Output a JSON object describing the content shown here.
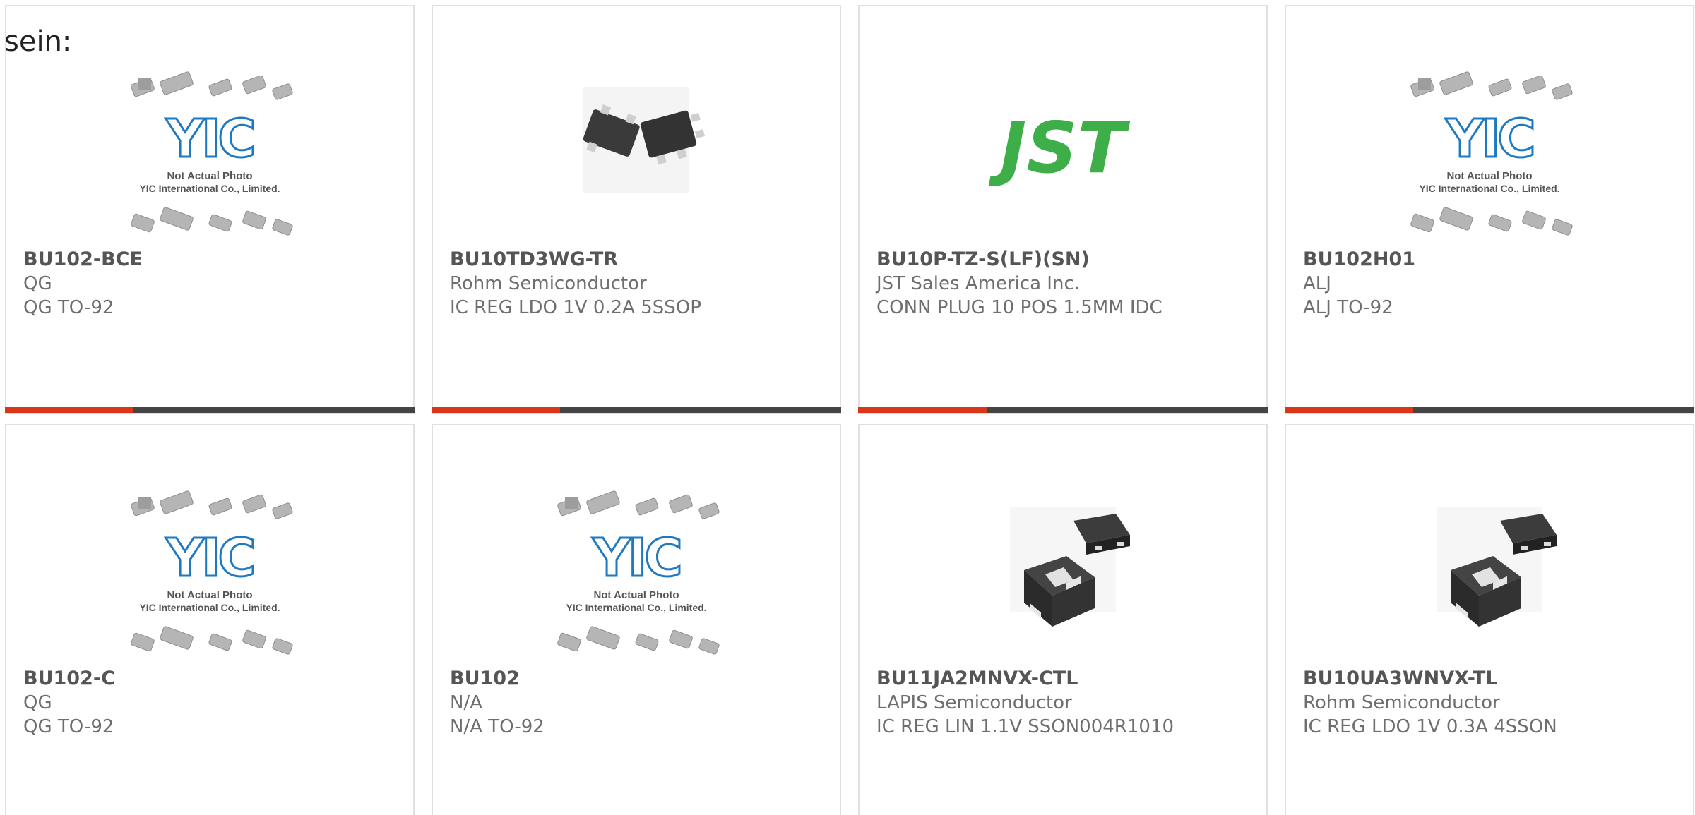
{
  "intro_text": "sein:",
  "accent_color": "#d9361a",
  "bar_color": "#444444",
  "cards": [
    {
      "part": "BU102-BCE",
      "maker": "QG",
      "desc": "QG TO-92",
      "image": "yic-placeholder",
      "placeholder_line1": "Not Actual Photo",
      "placeholder_line2": "YIC International Co., Limited."
    },
    {
      "part": "BU10TD3WG-TR",
      "maker": "Rohm Semiconductor",
      "desc": "IC REG LDO 1V 0.2A 5SSOP",
      "image": "sot-package-photo"
    },
    {
      "part": "BU10P-TZ-S(LF)(SN)",
      "maker": "JST Sales America Inc.",
      "desc": "CONN PLUG 10 POS 1.5MM IDC",
      "image": "jst-logo",
      "logo_text": "JST"
    },
    {
      "part": "BU102H01",
      "maker": "ALJ",
      "desc": "ALJ TO-92",
      "image": "yic-placeholder",
      "placeholder_line1": "Not Actual Photo",
      "placeholder_line2": "YIC International Co., Limited."
    },
    {
      "part": "BU102-C",
      "maker": "QG",
      "desc": "QG TO-92",
      "image": "yic-placeholder",
      "placeholder_line1": "Not Actual Photo",
      "placeholder_line2": "YIC International Co., Limited."
    },
    {
      "part": "BU102",
      "maker": "N/A",
      "desc": "N/A TO-92",
      "image": "yic-placeholder",
      "placeholder_line1": "Not Actual Photo",
      "placeholder_line2": "YIC International Co., Limited."
    },
    {
      "part": "BU11JA2MNVX-CTL",
      "maker": "LAPIS Semiconductor",
      "desc": "IC REG LIN 1.1V SSON004R1010",
      "image": "sson-package-photo"
    },
    {
      "part": "BU10UA3WNVX-TL",
      "maker": "Rohm Semiconductor",
      "desc": "IC REG LDO 1V 0.3A 4SSON",
      "image": "sson-package-photo"
    }
  ]
}
